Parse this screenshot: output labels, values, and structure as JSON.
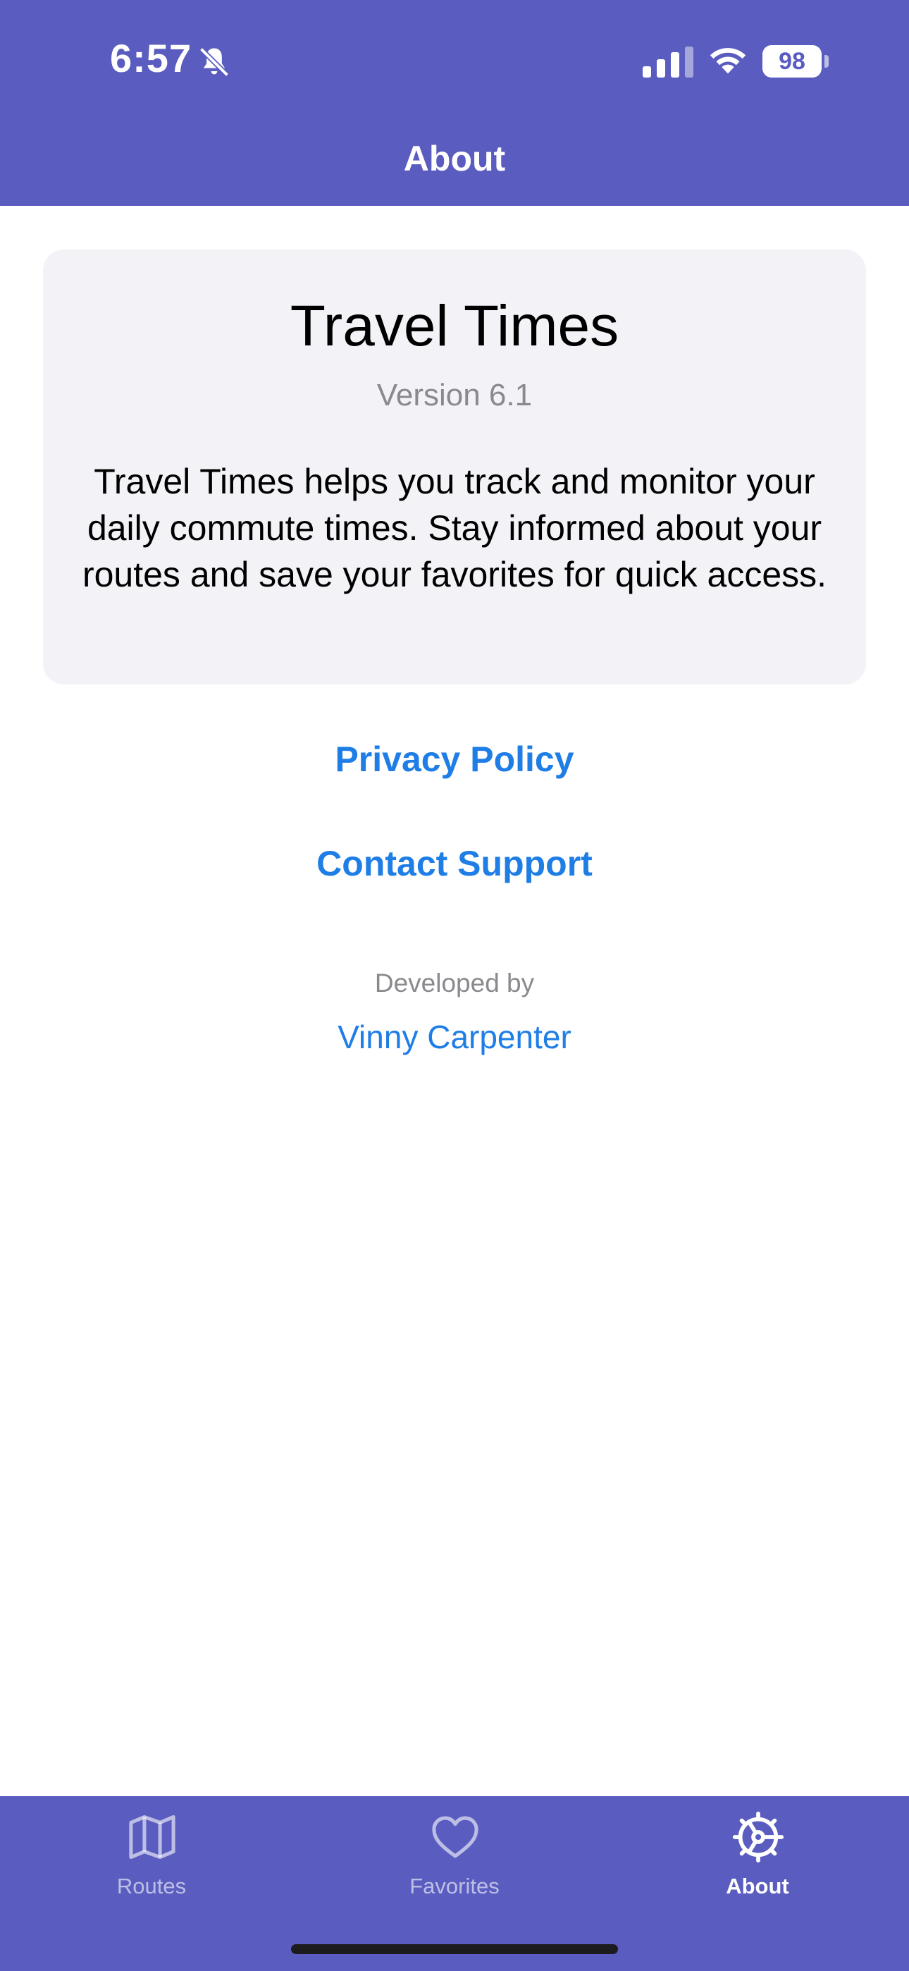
{
  "status_bar": {
    "time": "6:57",
    "battery": "98",
    "icons": [
      "bell-slash-icon",
      "cellular-signal-icon",
      "wifi-icon",
      "battery-icon"
    ]
  },
  "header": {
    "title": "About"
  },
  "card": {
    "app_name": "Travel Times",
    "version": "Version 6.1",
    "description": "Travel Times helps you track and monitor your daily commute times. Stay informed about your routes and save your favorites for quick access."
  },
  "links": {
    "privacy_policy": "Privacy Policy",
    "contact_support": "Contact Support"
  },
  "developer": {
    "caption": "Developed by",
    "name": "Vinny Carpenter"
  },
  "tab_bar": {
    "tabs": [
      {
        "label": "Routes",
        "icon": "map-icon",
        "active": false
      },
      {
        "label": "Favorites",
        "icon": "heart-icon",
        "active": false
      },
      {
        "label": "About",
        "icon": "gear-icon",
        "active": true
      }
    ]
  },
  "colors": {
    "header_bg": "#5a5dbf",
    "link": "#1f7ee6",
    "card_bg": "#f2f2f7",
    "secondary_text": "#8a8a8e"
  }
}
